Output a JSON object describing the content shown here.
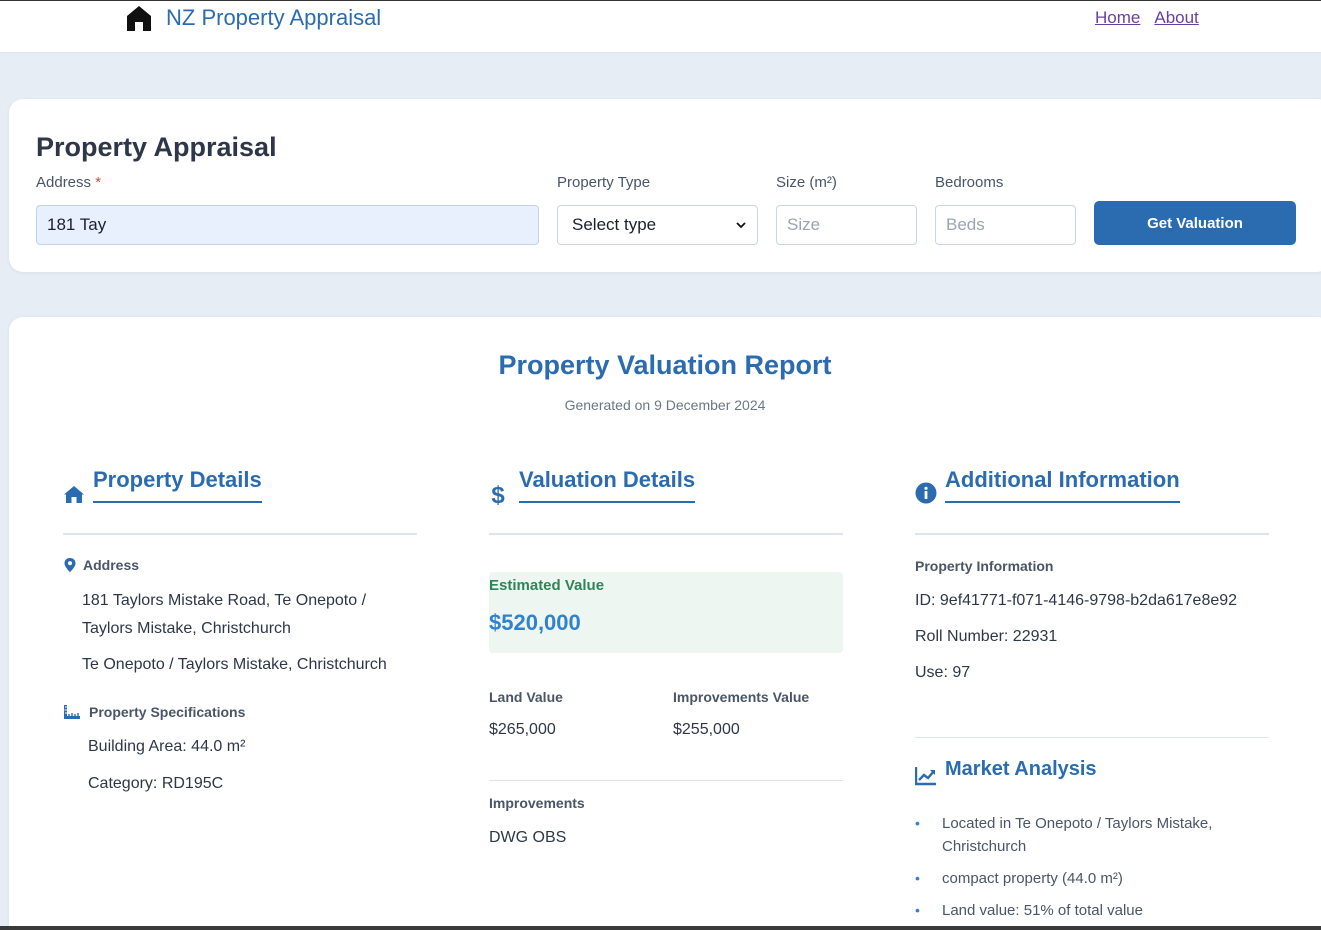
{
  "nav": {
    "brand": "NZ Property Appraisal",
    "brand_icon": "house-icon",
    "links": [
      "Home",
      "About"
    ]
  },
  "form": {
    "title": "Property Appraisal",
    "address_label": "Address",
    "required_mark": "*",
    "address_value": "181 Tay",
    "type_label": "Property Type",
    "type_value": "Select type",
    "size_label": "Size (m²)",
    "size_placeholder": "Size",
    "beds_label": "Bedrooms",
    "beds_placeholder": "Beds",
    "submit": "Get Valuation"
  },
  "report": {
    "title": "Property Valuation Report",
    "generated": "Generated on 9 December 2024",
    "property_details": {
      "title": "Property Details",
      "address_label": "Address",
      "address_full": "181 Taylors Mistake Road, Te Onepoto / Taylors Mistake, Christchurch",
      "address_suburb": "Te Onepoto / Taylors Mistake, Christchurch",
      "specs_label": "Property Specifications",
      "building_area": "Building Area: 44.0 m²",
      "category": "Category: RD195C"
    },
    "valuation_details": {
      "title": "Valuation Details",
      "estimated_label": "Estimated Value",
      "estimated_value": "$520,000",
      "land_label": "Land Value",
      "land_value": "$265,000",
      "improvements_value_label": "Improvements Value",
      "improvements_value": "$255,000",
      "improvements_label": "Improvements",
      "improvements": "DWG OBS"
    },
    "additional_info": {
      "title": "Additional Information",
      "info_label": "Property Information",
      "id": "ID: 9ef41771-f071-4146-9798-b2da617e8e92",
      "roll": "Roll Number: 22931",
      "use": "Use: 97"
    },
    "market_analysis": {
      "title": "Market Analysis",
      "items": [
        "Located in Te Onepoto / Taylors Mistake, Christchurch",
        "compact property (44.0 m²)",
        "Land value: 51% of total value"
      ]
    }
  },
  "colors": {
    "primary": "#2b6cb0",
    "accent": "#3182ce",
    "success": "#2f855a",
    "page_bg": "#e6edf5"
  }
}
